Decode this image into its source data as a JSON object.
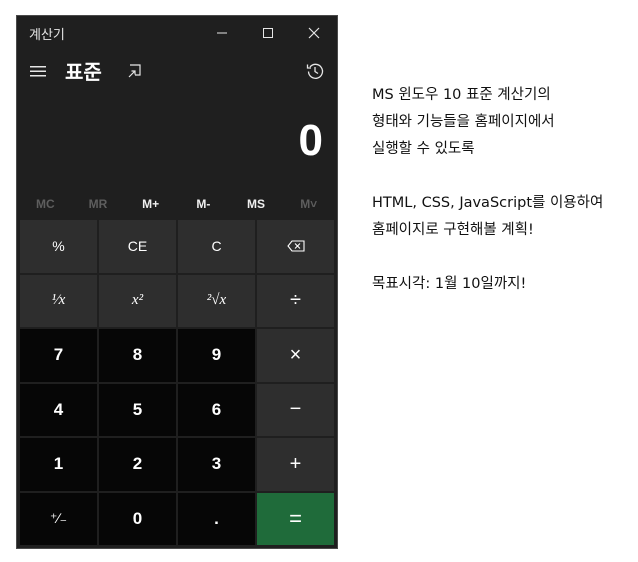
{
  "window": {
    "title": "계산기"
  },
  "header": {
    "mode_title": "표준"
  },
  "display": {
    "value": "0"
  },
  "memory": [
    {
      "label": "MC",
      "enabled": false
    },
    {
      "label": "MR",
      "enabled": false
    },
    {
      "label": "M+",
      "enabled": true
    },
    {
      "label": "M-",
      "enabled": true
    },
    {
      "label": "MS",
      "enabled": true
    },
    {
      "label": "M˅",
      "enabled": false
    }
  ],
  "keys": {
    "percent": "%",
    "ce": "CE",
    "c": "C",
    "backspace": "⌫",
    "reciprocal": "¹⁄x",
    "square": "x²",
    "sqrt": "²√x",
    "divide": "÷",
    "n7": "7",
    "n8": "8",
    "n9": "9",
    "multiply": "×",
    "n4": "4",
    "n5": "5",
    "n6": "6",
    "minus": "−",
    "n1": "1",
    "n2": "2",
    "n3": "3",
    "plus": "+",
    "negate": "⁺∕₋",
    "n0": "0",
    "dot": ".",
    "equals": "="
  },
  "notes": {
    "line1": "MS 윈도우 10 표준 계산기의",
    "line2": "형태와 기능들을 홈페이지에서",
    "line3": "실행할 수 있도록",
    "line4": "HTML, CSS, JavaScript를 이용하여",
    "line5": "홈페이지로 구현해볼 계획!",
    "line6": "목표시각: 1월 10일까지!"
  }
}
